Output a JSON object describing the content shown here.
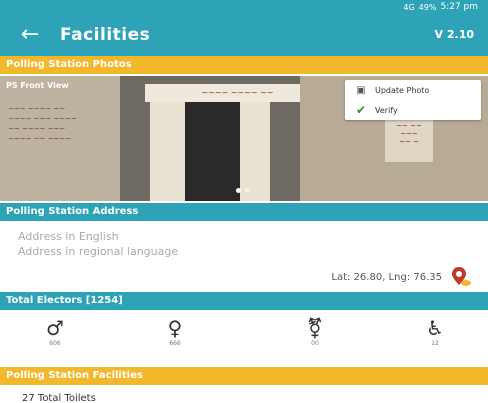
{
  "status_bar": {
    "signal_text": "4G",
    "battery": "49%",
    "time": "5:27 pm"
  },
  "header": {
    "title": "Facilities",
    "version": "V 2.10"
  },
  "photos_section": {
    "title": "Polling Station Photos",
    "photo_label": "PS Front View",
    "update_label": "Update Photo",
    "verify_label": "Verify"
  },
  "address_section": {
    "title": "Polling Station Address",
    "address_english": "Address in English",
    "address_regional": "Address in regional language",
    "latlng": "Lat: 26.80, Lng: 76.35"
  },
  "electors_section": {
    "title": "Total Electors [1254]",
    "counts": [
      {
        "icon": "male-icon",
        "value": "606"
      },
      {
        "icon": "female-icon",
        "value": "666"
      },
      {
        "icon": "third-gender-icon",
        "value": "00"
      },
      {
        "icon": "wheelchair-icon",
        "value": "12"
      }
    ]
  },
  "facilities_section": {
    "title": "Polling Station Facilities",
    "first_item": "27 Total Toilets"
  },
  "colors": {
    "primary": "#2ea3b8",
    "accent": "#f2b72a"
  }
}
